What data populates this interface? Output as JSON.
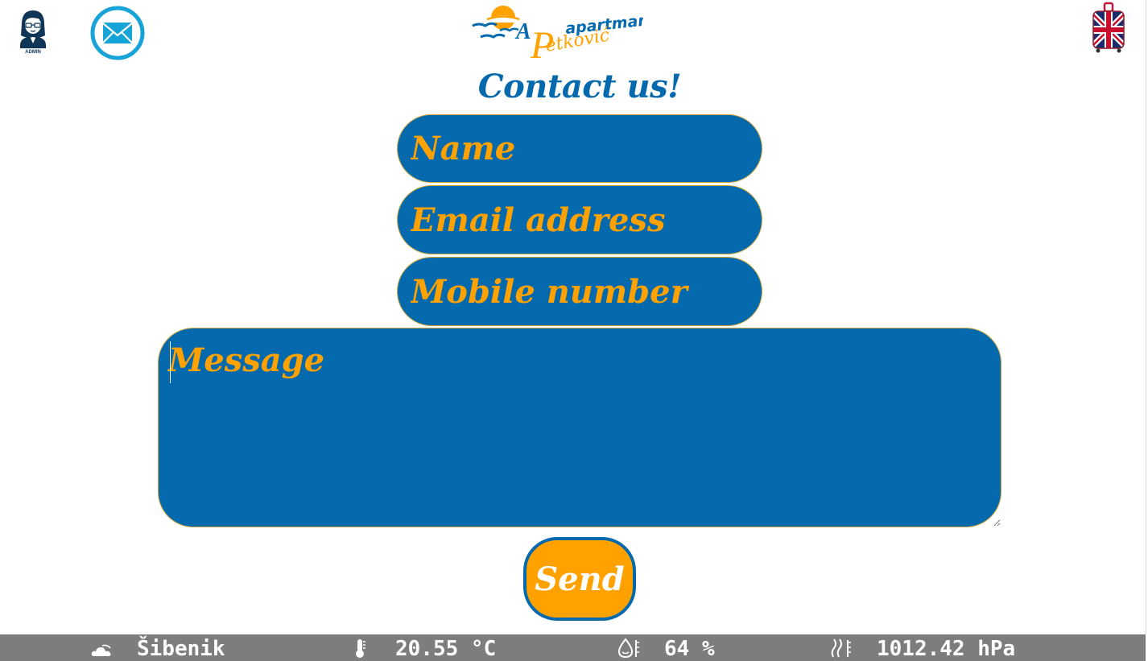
{
  "header": {
    "admin_icon": "admin-avatar-icon",
    "admin_label": "ADMIN",
    "mail_icon": "envelope-icon",
    "logo": {
      "text_a": "A",
      "text_p": "P",
      "text_apartmani": "apartmani",
      "text_petkovic": "etković"
    },
    "language_icon": "uk-flag-suitcase-icon"
  },
  "form": {
    "title": "Contact us!",
    "name_placeholder": "Name",
    "email_placeholder": "Email address",
    "mobile_placeholder": "Mobile number",
    "message_placeholder": "Message",
    "send_label": "Send"
  },
  "weather": {
    "city_icon": "cloud-icon",
    "city": "Šibenik",
    "temp_icon": "thermometer-icon",
    "temperature": "20.55 °C",
    "humidity_icon": "humidity-icon",
    "humidity": "64 %",
    "pressure_icon": "pressure-icon",
    "pressure": "1012.42 hPa"
  },
  "colors": {
    "primary_blue": "#0569ae",
    "accent_orange": "#ffa200",
    "footer_gray": "#7d7d7d",
    "icon_cyan": "#16a3d8"
  }
}
